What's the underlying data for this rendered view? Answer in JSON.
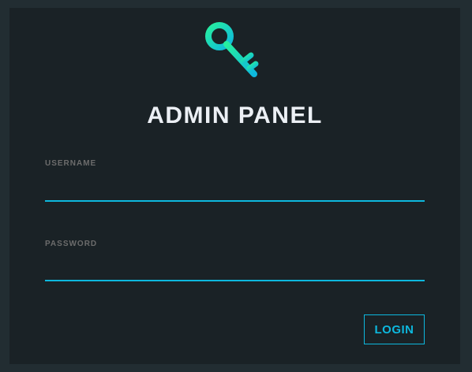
{
  "colors": {
    "page_background": "#222d32",
    "panel_background": "#1a2226",
    "accent": "#0db8de",
    "key_gradient_start": "#27ef9f",
    "key_gradient_end": "#0db8de",
    "title_text": "#ecf0f5",
    "label_text": "#6c6c6c"
  },
  "header": {
    "icon": "key-icon",
    "title": "ADMIN PANEL"
  },
  "form": {
    "username": {
      "label": "USERNAME",
      "value": "",
      "placeholder": ""
    },
    "password": {
      "label": "PASSWORD",
      "value": "",
      "placeholder": ""
    },
    "login_label": "LOGIN"
  }
}
